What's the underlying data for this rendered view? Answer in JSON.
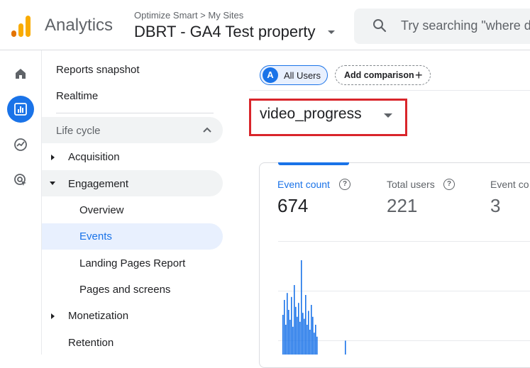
{
  "header": {
    "app_name": "Analytics",
    "breadcrumb": "Optimize Smart > My Sites",
    "property_name": "DBRT - GA4 Test property",
    "search_placeholder": "Try searching \"where d"
  },
  "nav": {
    "top_items": [
      "Reports snapshot",
      "Realtime"
    ],
    "section_title": "Life cycle",
    "acquisition": "Acquisition",
    "engagement": "Engagement",
    "engagement_children": [
      "Overview",
      "Events",
      "Landing Pages Report",
      "Pages and screens"
    ],
    "monetization": "Monetization",
    "retention": "Retention"
  },
  "comparison": {
    "avatar_letter": "A",
    "all_users": "All Users",
    "add_comparison": "Add comparison"
  },
  "event_selector": {
    "value": "video_progress"
  },
  "metrics": [
    {
      "label": "Event count",
      "value": "674"
    },
    {
      "label": "Total users",
      "value": "221"
    },
    {
      "label": "Event co",
      "value": "3"
    }
  ],
  "chart_data": {
    "type": "bar",
    "title": "",
    "xlabel": "",
    "ylabel": "",
    "values": [
      40,
      55,
      30,
      62,
      45,
      35,
      58,
      28,
      70,
      48,
      38,
      52,
      33,
      95,
      42,
      36,
      60,
      30,
      44,
      25,
      50,
      38,
      22,
      30,
      18,
      0,
      0,
      0,
      0,
      0,
      0,
      0,
      0,
      0,
      0,
      0,
      0,
      0,
      0,
      0,
      0,
      0,
      0,
      0,
      14,
      0,
      0,
      0,
      0,
      0
    ],
    "colors": {
      "bar": "#1a73e8"
    }
  },
  "colors": {
    "accent": "#1a73e8",
    "highlight": "#d9252b"
  }
}
